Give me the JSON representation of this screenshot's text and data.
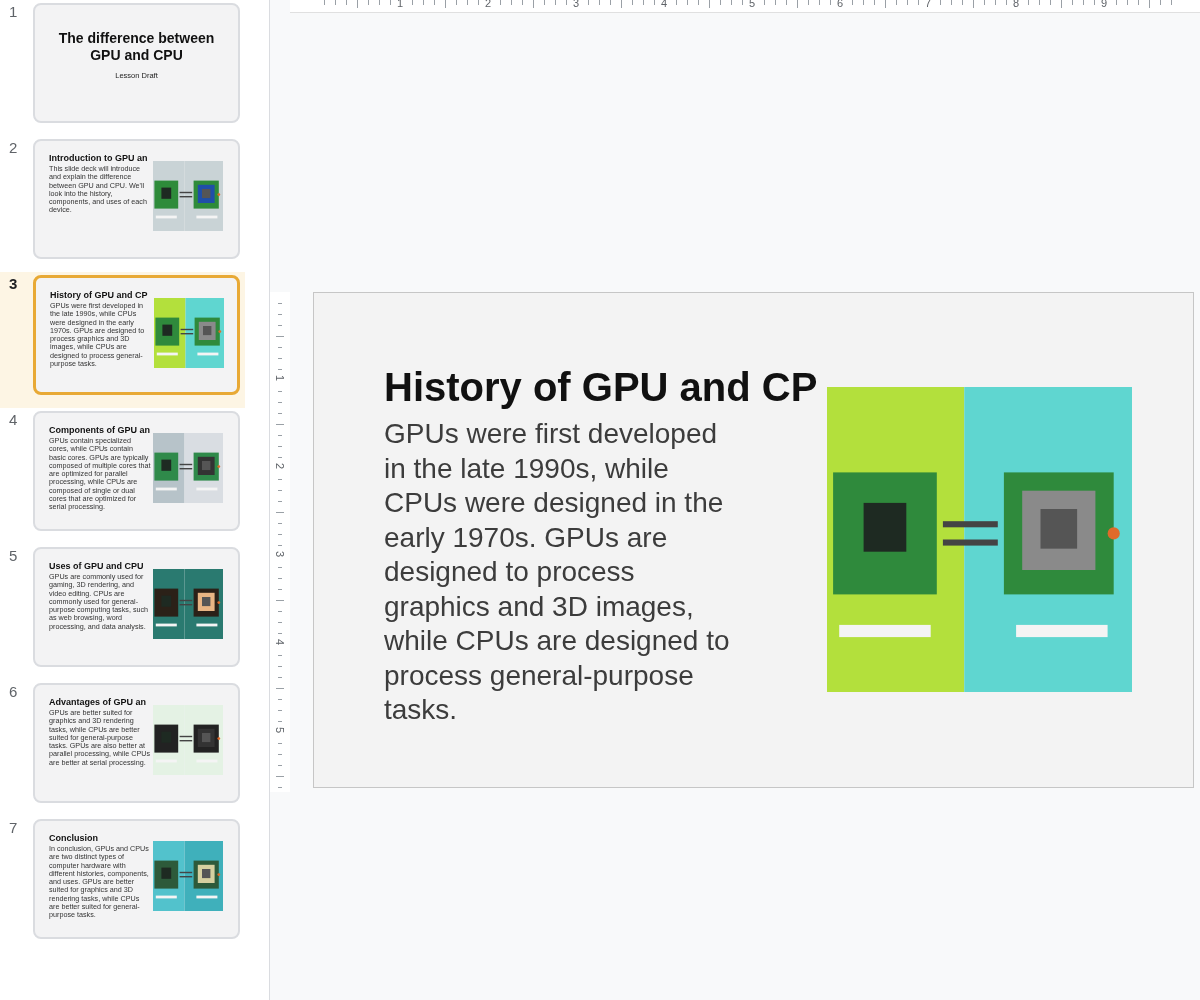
{
  "slides": [
    {
      "number": "1",
      "kind": "title",
      "selected": false,
      "title": "The difference between GPU and CPU",
      "subtitle": "Lesson Draft"
    },
    {
      "number": "2",
      "kind": "content",
      "selected": false,
      "title": "Introduction to GPU an",
      "body": "This slide deck will introduce and explain the difference between GPU and CPU. We'll look into the history, components, and uses of each device."
    },
    {
      "number": "3",
      "kind": "content",
      "selected": true,
      "title": "History of GPU and CP",
      "body": "GPUs were first developed in the late 1990s, while CPUs were designed in the early 1970s. GPUs are designed to process graphics and 3D images, while CPUs are designed to process general-purpose tasks."
    },
    {
      "number": "4",
      "kind": "content",
      "selected": false,
      "title": "Components of GPU an",
      "body": "GPUs contain specialized cores, while CPUs contain basic cores. GPUs are typically composed of multiple cores that are optimized for parallel processing, while CPUs are composed of single or dual cores that are optimized for serial processing."
    },
    {
      "number": "5",
      "kind": "content",
      "selected": false,
      "title": "Uses of GPU and CPU",
      "body": "GPUs are commonly used for gaming, 3D rendering, and video editing. CPUs are commonly used for general-purpose computing tasks, such as web browsing, word processing, and data analysis."
    },
    {
      "number": "6",
      "kind": "content",
      "selected": false,
      "title": "Advantages of GPU an",
      "body": "GPUs are better suited for graphics and 3D rendering tasks, while CPUs are better suited for general-purpose tasks. GPUs are also better at parallel processing, while CPUs are better at serial processing."
    },
    {
      "number": "7",
      "kind": "content",
      "selected": false,
      "title": "Conclusion",
      "body": "In conclusion, GPUs and CPUs are two distinct types of computer hardware with different histories, components, and uses. GPUs are better suited for graphics and 3D rendering tasks, while CPUs are better suited for general-purpose tasks."
    }
  ],
  "current_slide": {
    "title": "History of GPU and CP",
    "body": "GPUs were first developed in the late 1990s, while CPUs were designed in the early 1970s. GPUs are designed to process graphics and 3D images, while CPUs are designed to process general-purpose tasks."
  },
  "ruler_top": {
    "labels": [
      "1",
      "2",
      "3",
      "4",
      "5",
      "6",
      "7",
      "8",
      "9"
    ]
  },
  "ruler_left": {
    "labels": [
      "1",
      "2",
      "3",
      "4",
      "5"
    ]
  }
}
